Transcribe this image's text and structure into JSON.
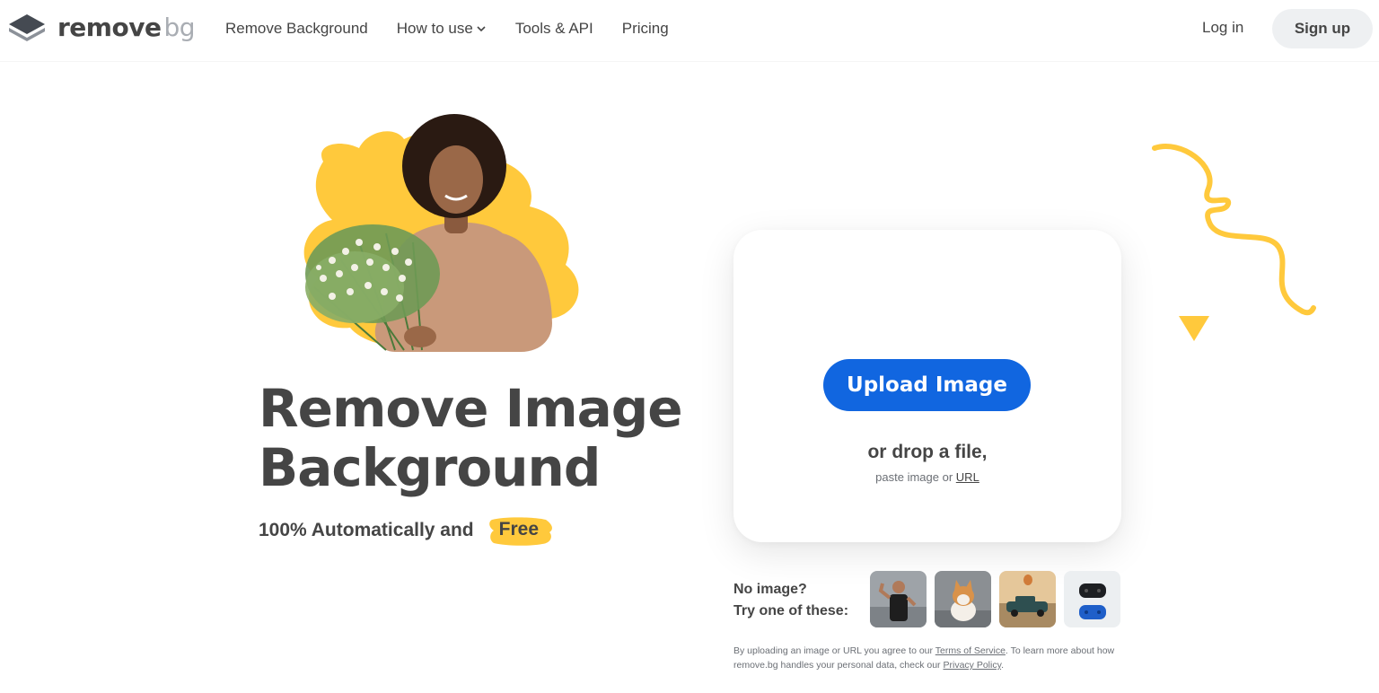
{
  "brand": {
    "name_main": "remove",
    "name_suffix": "bg",
    "accent_color": "#1166e0",
    "highlight_color": "#ffc93c"
  },
  "nav": {
    "items": [
      {
        "label": "Remove Background",
        "icon": null
      },
      {
        "label": "How to use",
        "icon": "chevron-down-icon"
      },
      {
        "label": "Tools & API",
        "icon": null
      },
      {
        "label": "Pricing",
        "icon": null
      }
    ],
    "login_label": "Log in",
    "signup_label": "Sign up"
  },
  "hero": {
    "title": "Remove Image Background",
    "subtitle_prefix": "100% Automatically and",
    "subtitle_badge": "Free"
  },
  "upload": {
    "button_label": "Upload Image",
    "drop_text": "or drop a file,",
    "paste_prefix": "paste image or",
    "paste_link": "URL"
  },
  "samples": {
    "line1": "No image?",
    "line2": "Try one of these:",
    "items": [
      "woman-flexing",
      "corgi-dog",
      "vintage-car",
      "game-controllers"
    ]
  },
  "legal": {
    "part1": "By uploading an image or URL you agree to our",
    "tos_link": "Terms of Service",
    "part2": ". To learn more about how remove.bg handles your personal data, check our",
    "privacy_link": "Privacy Policy",
    "part3": "."
  }
}
